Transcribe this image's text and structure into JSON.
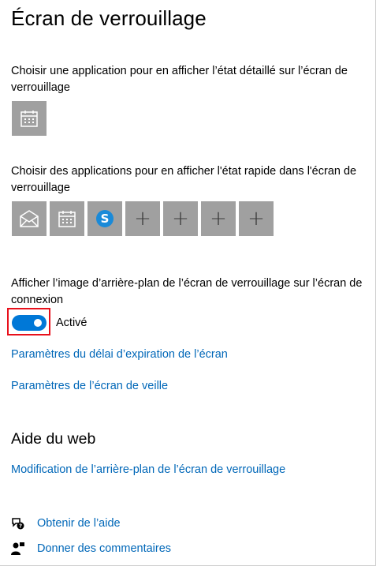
{
  "page": {
    "title": "Écran de verrouillage"
  },
  "detailed_status": {
    "label": "Choisir une application pour en afficher l’état détaillé sur l’écran de verrouillage",
    "app_icon": "calendar-icon"
  },
  "quick_status": {
    "label": "Choisir des applications pour en afficher l'état rapide dans l'écran de verrouillage",
    "apps": [
      {
        "icon": "mail-icon"
      },
      {
        "icon": "calendar-icon"
      },
      {
        "icon": "skype-icon",
        "glyph": "S"
      },
      {
        "icon": "plus-icon",
        "glyph": "+"
      },
      {
        "icon": "plus-icon",
        "glyph": "+"
      },
      {
        "icon": "plus-icon",
        "glyph": "+"
      },
      {
        "icon": "plus-icon",
        "glyph": "+"
      }
    ]
  },
  "background_login": {
    "label": "Afficher l’image d’arrière-plan de l’écran de verrouillage sur l’écran de connexion",
    "toggle_state": "Activé",
    "toggle_on": true
  },
  "links": {
    "timeout": "Paramètres du délai d’expiration de l’écran",
    "screensaver": "Paramètres de l’écran de veille"
  },
  "web_help": {
    "heading": "Aide du web",
    "link": "Modification de l’arrière-plan de l’écran de verrouillage"
  },
  "help": {
    "get_help": "Obtenir de l’aide",
    "feedback": "Donner des commentaires"
  },
  "colors": {
    "accent": "#0078d7",
    "link": "#0067b8",
    "tile": "#a0a0a0",
    "highlight": "#e8101b"
  }
}
